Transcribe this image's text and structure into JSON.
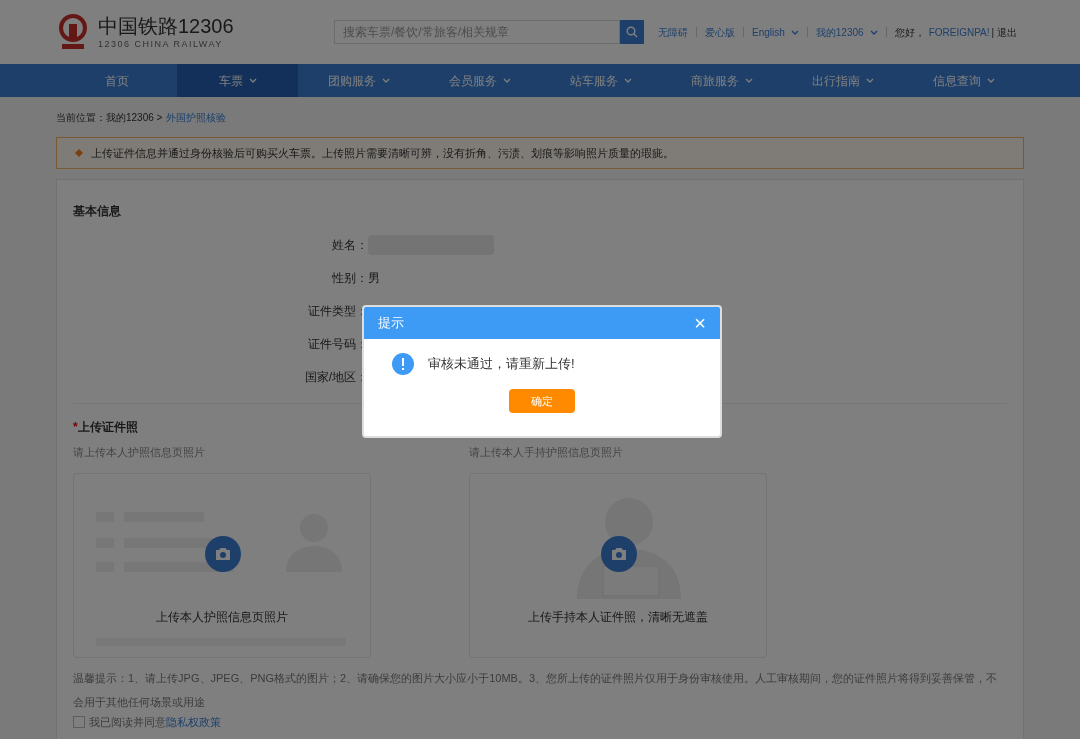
{
  "header": {
    "logo_title": "中国铁路12306",
    "logo_subtitle": "12306 CHINA RAILWAY",
    "search": {
      "placeholder": "搜索车票/餐饮/常旅客/相关规章"
    },
    "links": [
      {
        "label": "无障碍",
        "dropdown": false
      },
      {
        "label": "爱心版",
        "dropdown": false
      },
      {
        "label": "English",
        "dropdown": true
      },
      {
        "label": "我的12306",
        "dropdown": true
      }
    ],
    "greeting": "您好，",
    "user": "FOREIGNPA!",
    "logout": "| 退出"
  },
  "nav": [
    {
      "label": "首页",
      "selected": false,
      "dropdown": false
    },
    {
      "label": "车票",
      "selected": true,
      "dropdown": true
    },
    {
      "label": "团购服务",
      "selected": false,
      "dropdown": true
    },
    {
      "label": "会员服务",
      "selected": false,
      "dropdown": true
    },
    {
      "label": "站车服务",
      "selected": false,
      "dropdown": true
    },
    {
      "label": "商旅服务",
      "selected": false,
      "dropdown": true
    },
    {
      "label": "出行指南",
      "selected": false,
      "dropdown": true
    },
    {
      "label": "信息查询",
      "selected": false,
      "dropdown": true
    }
  ],
  "breadcrumb": {
    "prefix": "当前位置：我的12306 >",
    "current": "外国护照核验"
  },
  "notice": "上传证件信息并通过身份核验后可购买火车票。上传照片需要清晰可辨，没有折角、污渍、划痕等影响照片质量的瑕疵。",
  "basic_info": {
    "title": "基本信息",
    "fields": [
      {
        "label": "姓名：",
        "kind": "redacted"
      },
      {
        "label": "性别：",
        "kind": "text",
        "value": "男"
      },
      {
        "label": "证件类型：",
        "kind": "hidden"
      },
      {
        "label": "证件号码：",
        "kind": "hidden"
      },
      {
        "label": "国家/地区：",
        "kind": "hidden"
      }
    ]
  },
  "upload": {
    "required_mark": "*",
    "title": "上传证件照",
    "slots": [
      {
        "hint": "请上传本人护照信息页照片",
        "caption": "上传本人护照信息页照片",
        "kind": "passport"
      },
      {
        "hint": "请上传本人手持护照信息页照片",
        "caption": "上传手持本人证件照，清晰无遮盖",
        "kind": "holding"
      }
    ]
  },
  "tips": "温馨提示：1、请上传JPG、JPEG、PNG格式的图片；2、请确保您的图片大小应小于10MB。3、您所上传的证件照片仅用于身份审核使用。人工审核期间，您的证件照片将得到妥善保管，不会用于其他任何场景或用途",
  "agreement": {
    "checked": false,
    "text": "我已阅读并同意",
    "link": "隐私权政策"
  },
  "dialog": {
    "title": "提示",
    "close": "×",
    "message": "审核未通过，请重新上传!",
    "button": "确定"
  }
}
